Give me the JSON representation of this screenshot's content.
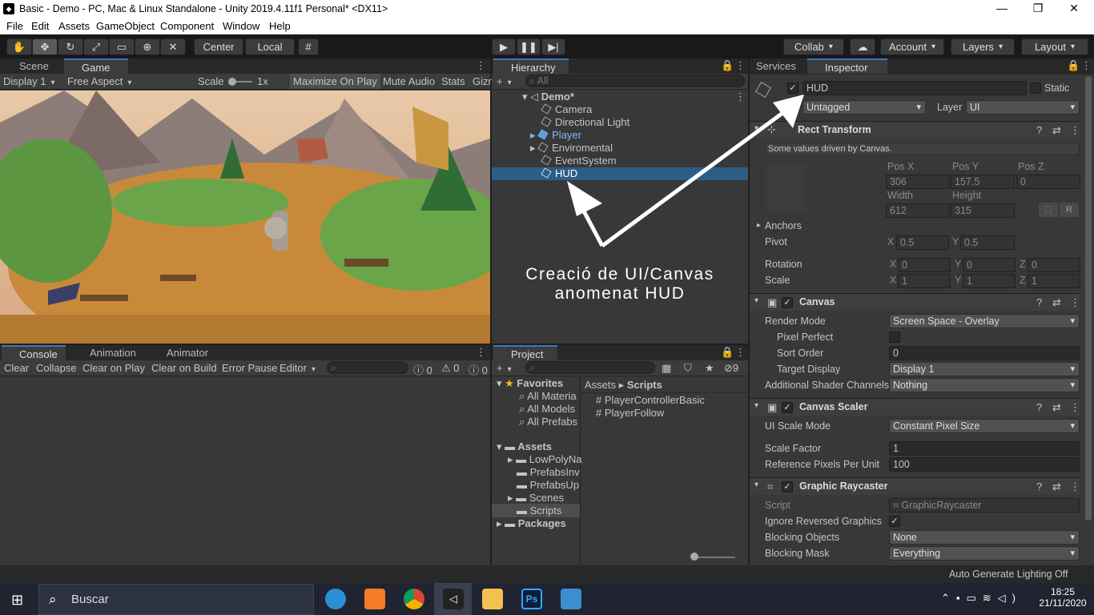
{
  "window": {
    "title": "Basic - Demo - PC, Mac & Linux Standalone - Unity 2019.4.11f1 Personal* <DX11>",
    "min": "—",
    "max": "❐",
    "close": "✕"
  },
  "menu": [
    "File",
    "Edit",
    "Assets",
    "GameObject",
    "Component",
    "Window",
    "Help"
  ],
  "toolbar": {
    "center": "Center",
    "local": "Local",
    "collab": "Collab",
    "account": "Account",
    "layers": "Layers",
    "layout": "Layout"
  },
  "scene": {
    "tab_scene": "Scene",
    "tab_game": "Game",
    "display": "Display 1",
    "aspect": "Free Aspect",
    "scale_label": "Scale",
    "scale_value": "1x",
    "maximize": "Maximize On Play",
    "mute": "Mute Audio",
    "stats": "Stats",
    "gizmos": "Gizm"
  },
  "hierarchy": {
    "tab": "Hierarchy",
    "search_placeholder": "All",
    "scene_name": "Demo*",
    "items": [
      {
        "label": "Camera"
      },
      {
        "label": "Directional Light"
      },
      {
        "label": "Player"
      },
      {
        "label": "Enviromental"
      },
      {
        "label": "EventSystem"
      },
      {
        "label": "HUD"
      }
    ]
  },
  "annotation": {
    "line1": "Creació de UI/Canvas",
    "line2": "anomenat HUD"
  },
  "inspector": {
    "tab_services": "Services",
    "tab_inspector": "Inspector",
    "object_name": "HUD",
    "static": "Static",
    "tag_label": "Tag",
    "tag": "Untagged",
    "layer_label": "Layer",
    "layer": "UI",
    "rect": {
      "title": "Rect Transform",
      "note": "Some values driven by Canvas.",
      "posx_label": "Pos X",
      "posy_label": "Pos Y",
      "posz_label": "Pos Z",
      "posx": "306",
      "posy": "157.5",
      "posz": "0",
      "width_label": "Width",
      "height_label": "Height",
      "width": "612",
      "height": "315",
      "anchors": "Anchors",
      "pivot": "Pivot",
      "pivot_x": "0.5",
      "pivot_y": "0.5",
      "rotation": "Rotation",
      "rot_x": "0",
      "rot_y": "0",
      "rot_z": "0",
      "scale": "Scale",
      "scale_x": "1",
      "scale_y": "1",
      "scale_z": "1",
      "r": "R"
    },
    "canvas": {
      "title": "Canvas",
      "render_mode_label": "Render Mode",
      "render_mode": "Screen Space - Overlay",
      "pixel_perfect": "Pixel Perfect",
      "sort_order_label": "Sort Order",
      "sort_order": "0",
      "target_display_label": "Target Display",
      "target_display": "Display 1",
      "shader_label": "Additional Shader Channels",
      "shader": "Nothing"
    },
    "scaler": {
      "title": "Canvas Scaler",
      "mode_label": "UI Scale Mode",
      "mode": "Constant Pixel Size",
      "factor_label": "Scale Factor",
      "factor": "1",
      "ppu_label": "Reference Pixels Per Unit",
      "ppu": "100"
    },
    "raycaster": {
      "title": "Graphic Raycaster",
      "script_label": "Script",
      "script": "GraphicRaycaster",
      "ignore_label": "Ignore Reversed Graphics",
      "blocking_label": "Blocking Objects",
      "blocking": "None",
      "mask_label": "Blocking Mask",
      "mask": "Everything"
    }
  },
  "console": {
    "tab_console": "Console",
    "tab_animation": "Animation",
    "tab_animator": "Animator",
    "clear": "Clear",
    "collapse": "Collapse",
    "clear_on_play": "Clear on Play",
    "clear_on_build": "Clear on Build",
    "error_pause": "Error Pause",
    "editor": "Editor",
    "count_log": "0",
    "count_warn": "0",
    "count_err": "0"
  },
  "project": {
    "tab": "Project",
    "hidden_count": "9",
    "favorites": "Favorites",
    "fav_items": [
      "All Materia",
      "All Models",
      "All Prefabs"
    ],
    "assets": "Assets",
    "folders": [
      "LowPolyNa",
      "PrefabsInv",
      "PrefabsUp",
      "Scenes",
      "Scripts"
    ],
    "packages": "Packages",
    "breadcrumb_root": "Assets",
    "breadcrumb_leaf": "Scripts",
    "files": [
      "PlayerControllerBasic",
      "PlayerFollow"
    ]
  },
  "status": {
    "lighting": "Auto Generate Lighting Off"
  },
  "taskbar": {
    "search": "Buscar",
    "time": "18:25",
    "date": "21/11/2020"
  }
}
